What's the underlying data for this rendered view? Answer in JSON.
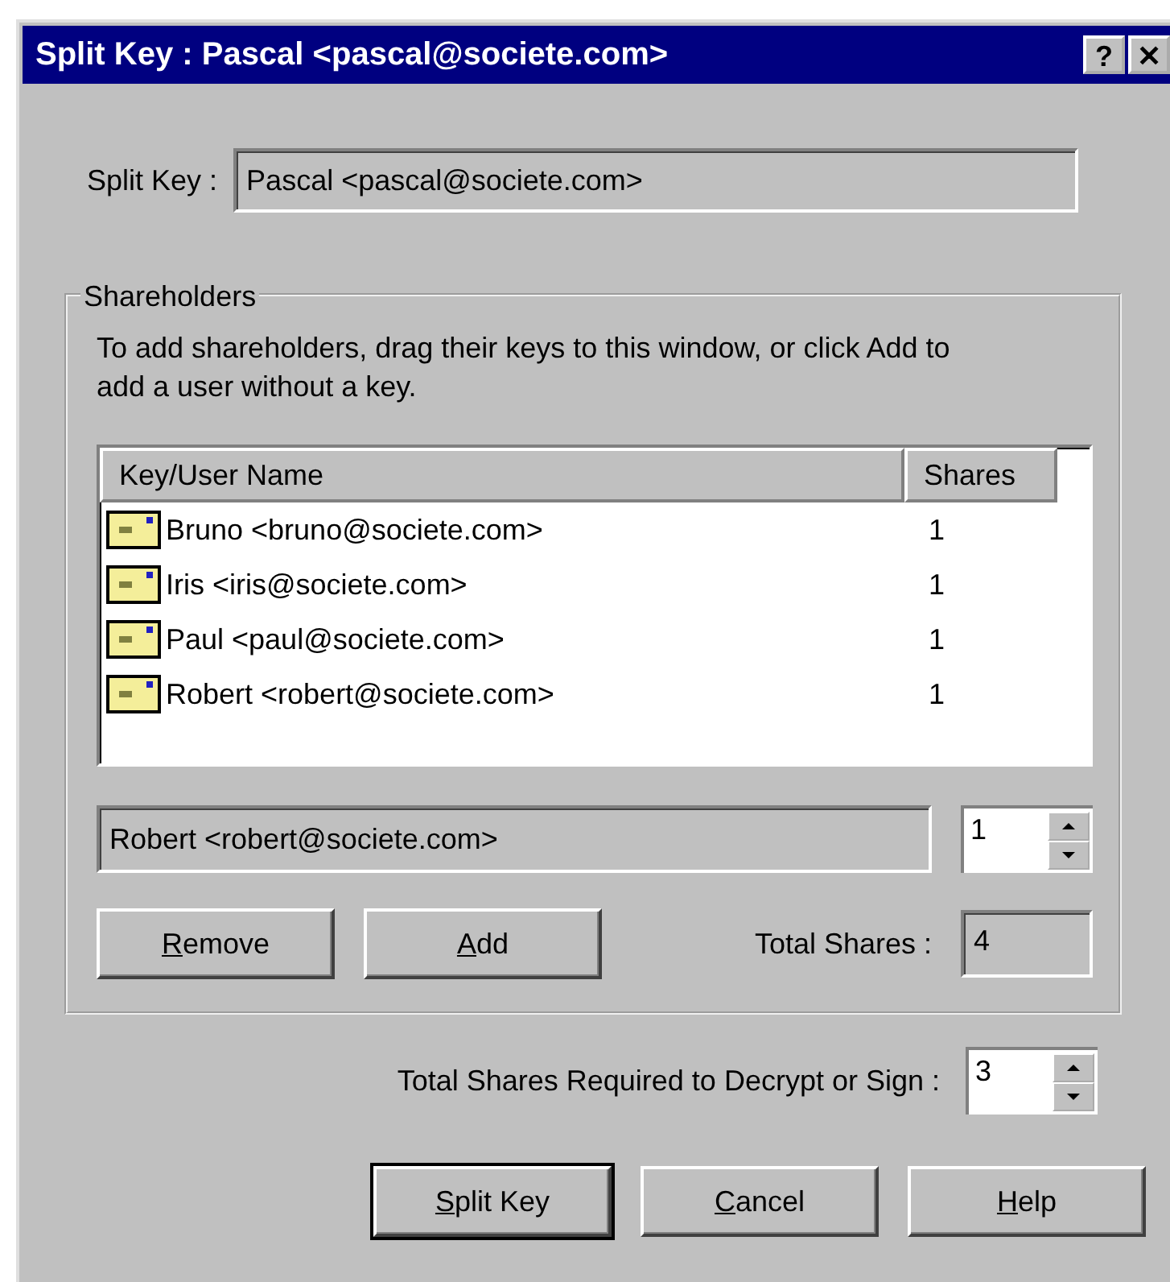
{
  "window": {
    "title": "Split Key : Pascal <pascal@societe.com>",
    "title_buttons": [
      "?",
      "✕"
    ]
  },
  "split_key": {
    "label": "Split Key :",
    "value": "Pascal <pascal@societe.com>"
  },
  "shareholders": {
    "legend": "Shareholders",
    "instructions": "To add shareholders, drag their keys to this window, or click Add to add a user without a key.",
    "table": {
      "columns": [
        "Key/User Name",
        "Shares"
      ],
      "rows": [
        {
          "name": "Bruno <bruno@societe.com>",
          "shares": "1"
        },
        {
          "name": "Iris <iris@societe.com>",
          "shares": "1"
        },
        {
          "name": "Paul <paul@societe.com>",
          "shares": "1"
        },
        {
          "name": "Robert <robert@societe.com>",
          "shares": "1"
        }
      ]
    },
    "selected_name": "Robert <robert@societe.com>",
    "selected_shares": "1",
    "buttons": [
      {
        "label": "Remove",
        "mnemonic_first": true
      },
      {
        "label": "Add",
        "mnemonic_first": true
      }
    ],
    "total_label": "Total Shares :",
    "total_value": "4"
  },
  "required": {
    "label": "Total Shares Required to Decrypt or Sign :",
    "value": "3"
  },
  "buttons": [
    {
      "label": "Split Key",
      "mnemonic_first": true,
      "default": true
    },
    {
      "label": "Cancel",
      "mnemonic_first": true,
      "default": false
    },
    {
      "label": "Help",
      "mnemonic_first": true,
      "default": false
    }
  ]
}
